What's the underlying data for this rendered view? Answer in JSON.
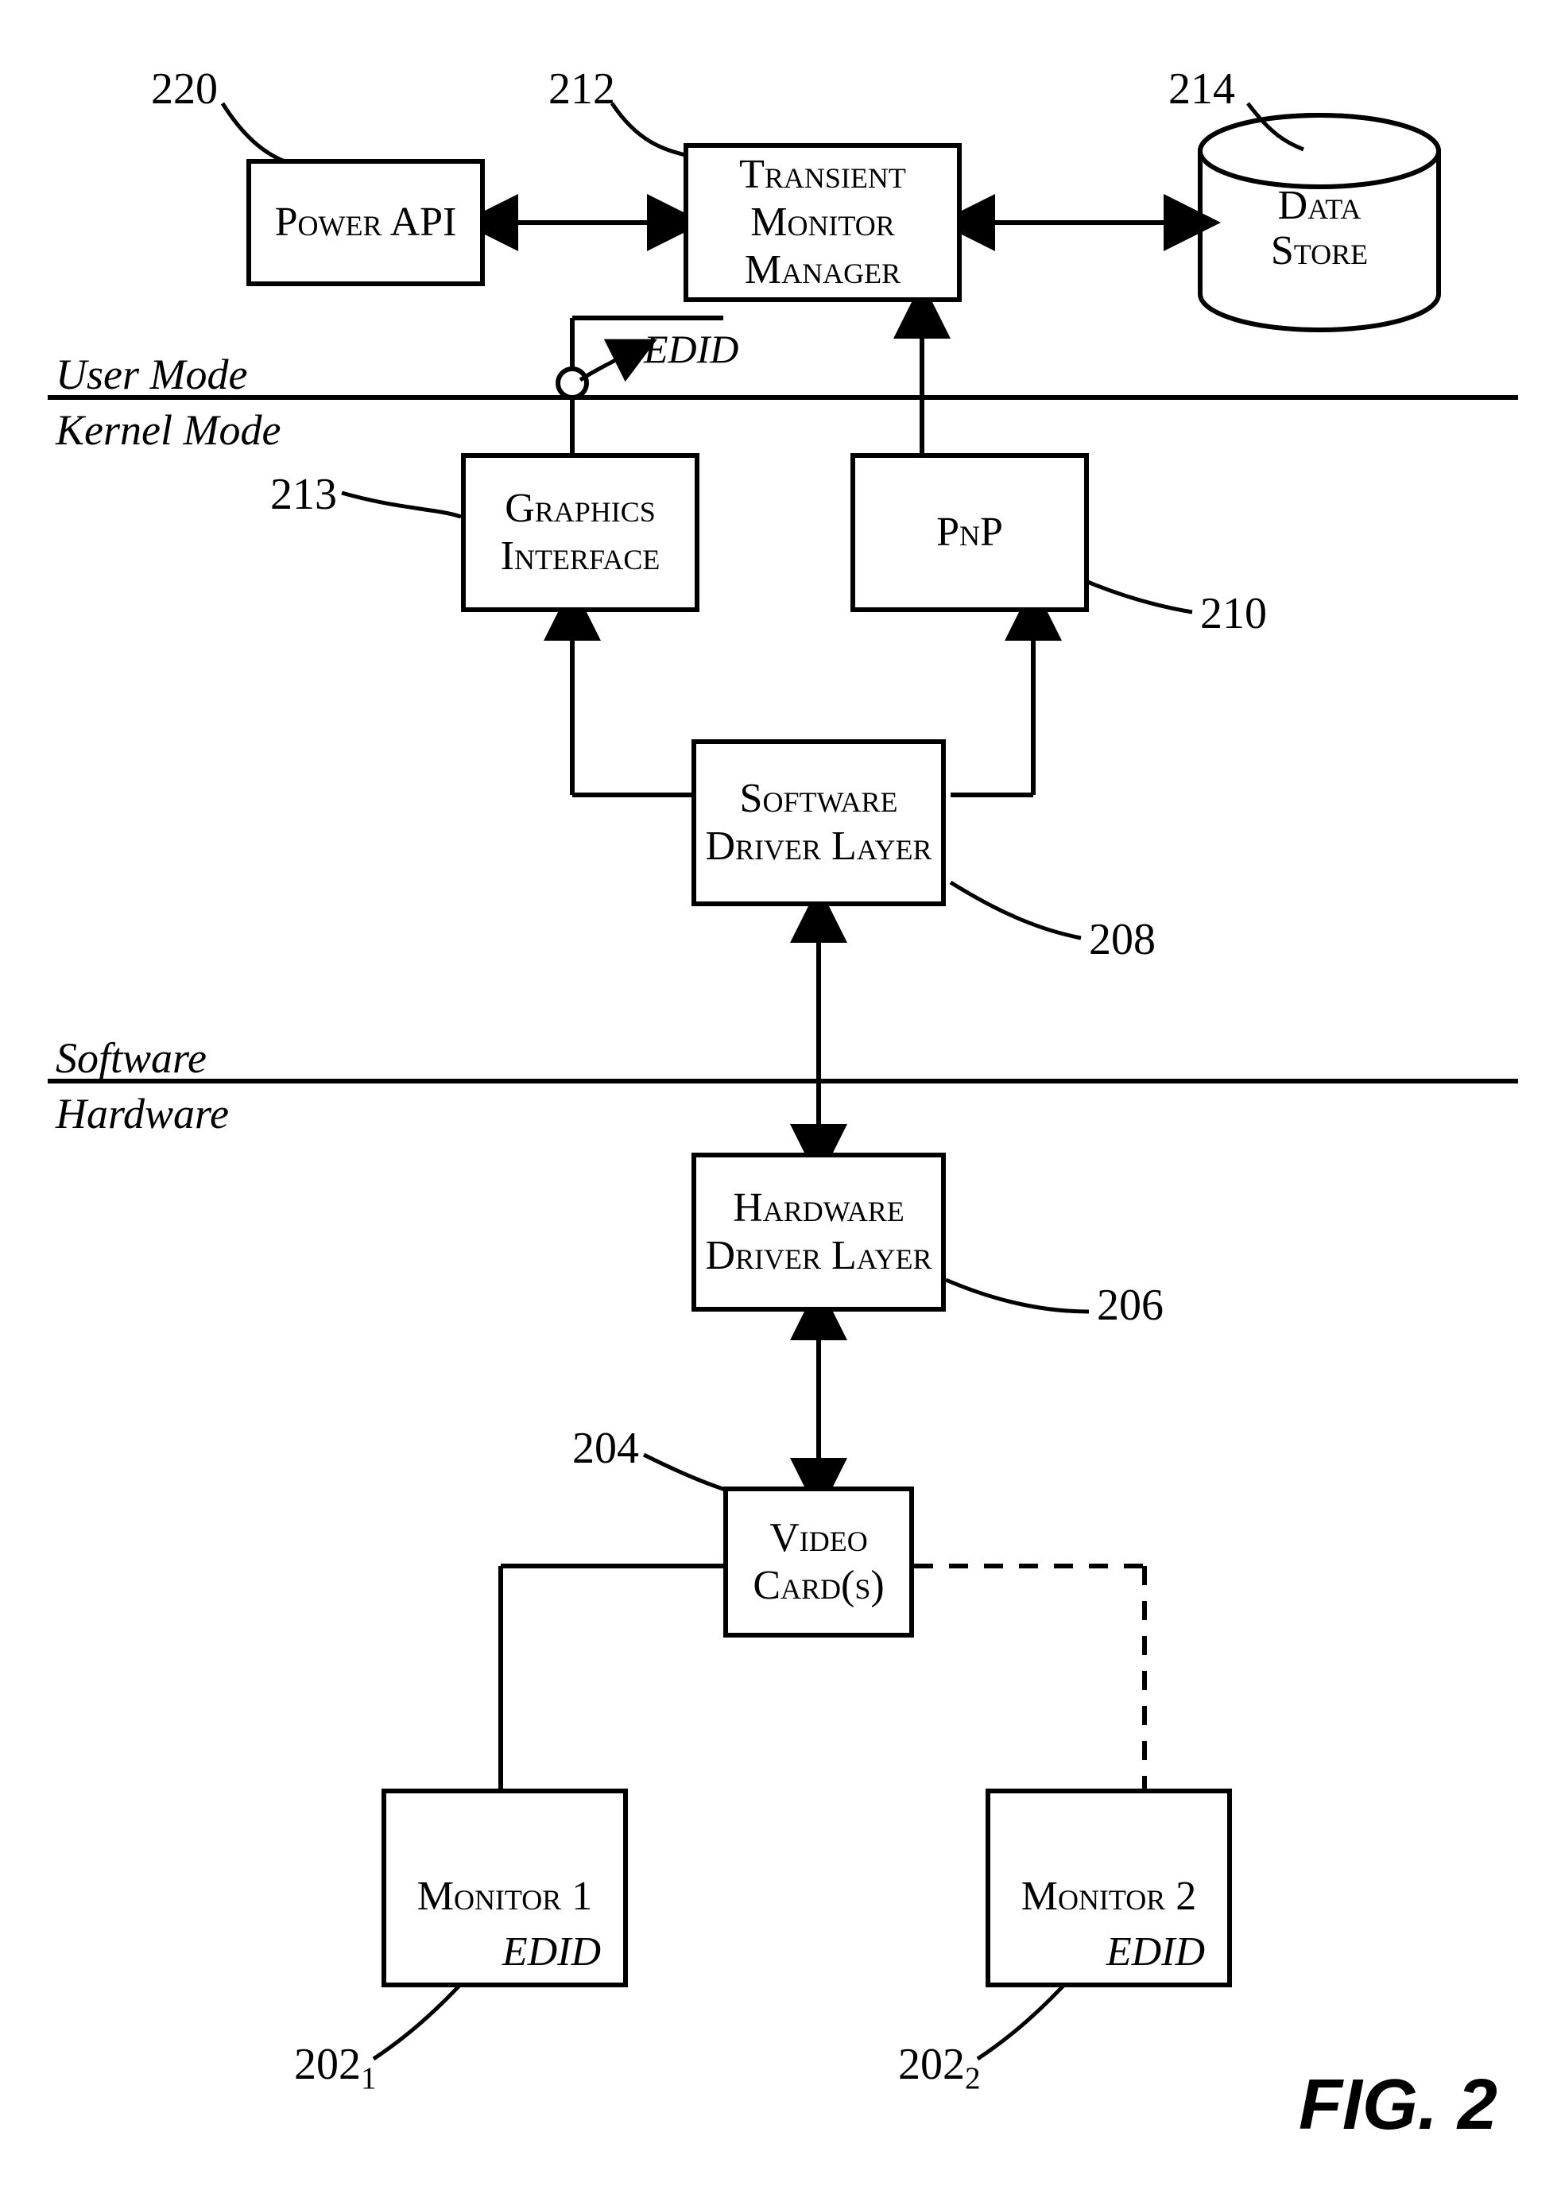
{
  "refs": {
    "n220": "220",
    "n212": "212",
    "n214": "214",
    "n213": "213",
    "n210": "210",
    "n208": "208",
    "n206": "206",
    "n204": "204",
    "n202_1": "202",
    "n202_2": "202"
  },
  "boxes": {
    "power_api": "Power API",
    "tmm": "Transient Monitor Manager",
    "data_store": "Data Store",
    "graphics_interface": "Graphics Interface",
    "pnp": "PnP",
    "sdl": "Software Driver Layer",
    "hdl": "Hardware Driver Layer",
    "video": "Video Card(s)",
    "monitor1": "Monitor 1",
    "monitor2": "Monitor 2",
    "edid": "EDID"
  },
  "regions": {
    "user_mode": "User Mode",
    "kernel_mode": "Kernel Mode",
    "software": "Software",
    "hardware": "Hardware"
  },
  "figure": "FIG. 2"
}
